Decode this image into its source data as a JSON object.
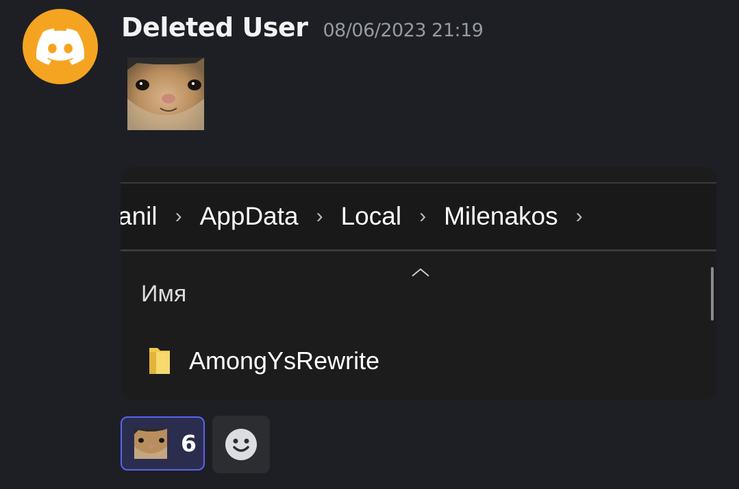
{
  "message": {
    "author": "Deleted User",
    "timestamp": "08/06/2023 21:19",
    "avatar_icon": "discord-logo-icon",
    "avatar_color": "#f5a422",
    "emoji": "cat-face-emoji"
  },
  "attachment": {
    "breadcrumb": [
      "anil",
      "AppData",
      "Local",
      "Milenakos"
    ],
    "breadcrumb_separator": "›",
    "column_header": "Имя",
    "files": [
      {
        "name": "AmongYsRewrite",
        "icon": "folder-icon"
      }
    ]
  },
  "reactions": [
    {
      "emoji": "cat-face-emoji",
      "count": "6",
      "active": true
    }
  ],
  "add_reaction_icon": "add-reaction-smiley-icon",
  "colors": {
    "background": "#1e1f24",
    "accent": "#5865f2",
    "reaction_bg": "#2b2d4e"
  }
}
